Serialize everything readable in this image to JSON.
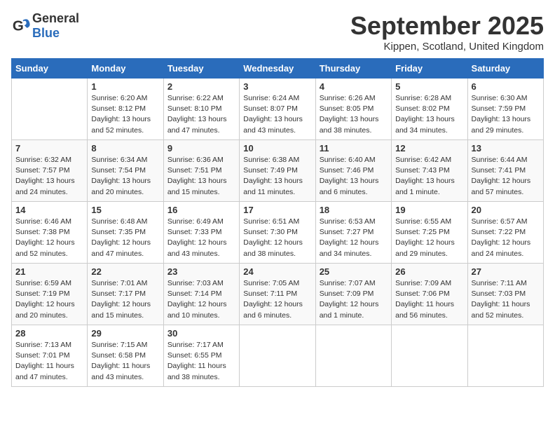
{
  "header": {
    "logo_general": "General",
    "logo_blue": "Blue",
    "month_title": "September 2025",
    "location": "Kippen, Scotland, United Kingdom"
  },
  "weekdays": [
    "Sunday",
    "Monday",
    "Tuesday",
    "Wednesday",
    "Thursday",
    "Friday",
    "Saturday"
  ],
  "weeks": [
    [
      {
        "day": "",
        "sunrise": "",
        "sunset": "",
        "daylight": ""
      },
      {
        "day": "1",
        "sunrise": "Sunrise: 6:20 AM",
        "sunset": "Sunset: 8:12 PM",
        "daylight": "Daylight: 13 hours and 52 minutes."
      },
      {
        "day": "2",
        "sunrise": "Sunrise: 6:22 AM",
        "sunset": "Sunset: 8:10 PM",
        "daylight": "Daylight: 13 hours and 47 minutes."
      },
      {
        "day": "3",
        "sunrise": "Sunrise: 6:24 AM",
        "sunset": "Sunset: 8:07 PM",
        "daylight": "Daylight: 13 hours and 43 minutes."
      },
      {
        "day": "4",
        "sunrise": "Sunrise: 6:26 AM",
        "sunset": "Sunset: 8:05 PM",
        "daylight": "Daylight: 13 hours and 38 minutes."
      },
      {
        "day": "5",
        "sunrise": "Sunrise: 6:28 AM",
        "sunset": "Sunset: 8:02 PM",
        "daylight": "Daylight: 13 hours and 34 minutes."
      },
      {
        "day": "6",
        "sunrise": "Sunrise: 6:30 AM",
        "sunset": "Sunset: 7:59 PM",
        "daylight": "Daylight: 13 hours and 29 minutes."
      }
    ],
    [
      {
        "day": "7",
        "sunrise": "Sunrise: 6:32 AM",
        "sunset": "Sunset: 7:57 PM",
        "daylight": "Daylight: 13 hours and 24 minutes."
      },
      {
        "day": "8",
        "sunrise": "Sunrise: 6:34 AM",
        "sunset": "Sunset: 7:54 PM",
        "daylight": "Daylight: 13 hours and 20 minutes."
      },
      {
        "day": "9",
        "sunrise": "Sunrise: 6:36 AM",
        "sunset": "Sunset: 7:51 PM",
        "daylight": "Daylight: 13 hours and 15 minutes."
      },
      {
        "day": "10",
        "sunrise": "Sunrise: 6:38 AM",
        "sunset": "Sunset: 7:49 PM",
        "daylight": "Daylight: 13 hours and 11 minutes."
      },
      {
        "day": "11",
        "sunrise": "Sunrise: 6:40 AM",
        "sunset": "Sunset: 7:46 PM",
        "daylight": "Daylight: 13 hours and 6 minutes."
      },
      {
        "day": "12",
        "sunrise": "Sunrise: 6:42 AM",
        "sunset": "Sunset: 7:43 PM",
        "daylight": "Daylight: 13 hours and 1 minute."
      },
      {
        "day": "13",
        "sunrise": "Sunrise: 6:44 AM",
        "sunset": "Sunset: 7:41 PM",
        "daylight": "Daylight: 12 hours and 57 minutes."
      }
    ],
    [
      {
        "day": "14",
        "sunrise": "Sunrise: 6:46 AM",
        "sunset": "Sunset: 7:38 PM",
        "daylight": "Daylight: 12 hours and 52 minutes."
      },
      {
        "day": "15",
        "sunrise": "Sunrise: 6:48 AM",
        "sunset": "Sunset: 7:35 PM",
        "daylight": "Daylight: 12 hours and 47 minutes."
      },
      {
        "day": "16",
        "sunrise": "Sunrise: 6:49 AM",
        "sunset": "Sunset: 7:33 PM",
        "daylight": "Daylight: 12 hours and 43 minutes."
      },
      {
        "day": "17",
        "sunrise": "Sunrise: 6:51 AM",
        "sunset": "Sunset: 7:30 PM",
        "daylight": "Daylight: 12 hours and 38 minutes."
      },
      {
        "day": "18",
        "sunrise": "Sunrise: 6:53 AM",
        "sunset": "Sunset: 7:27 PM",
        "daylight": "Daylight: 12 hours and 34 minutes."
      },
      {
        "day": "19",
        "sunrise": "Sunrise: 6:55 AM",
        "sunset": "Sunset: 7:25 PM",
        "daylight": "Daylight: 12 hours and 29 minutes."
      },
      {
        "day": "20",
        "sunrise": "Sunrise: 6:57 AM",
        "sunset": "Sunset: 7:22 PM",
        "daylight": "Daylight: 12 hours and 24 minutes."
      }
    ],
    [
      {
        "day": "21",
        "sunrise": "Sunrise: 6:59 AM",
        "sunset": "Sunset: 7:19 PM",
        "daylight": "Daylight: 12 hours and 20 minutes."
      },
      {
        "day": "22",
        "sunrise": "Sunrise: 7:01 AM",
        "sunset": "Sunset: 7:17 PM",
        "daylight": "Daylight: 12 hours and 15 minutes."
      },
      {
        "day": "23",
        "sunrise": "Sunrise: 7:03 AM",
        "sunset": "Sunset: 7:14 PM",
        "daylight": "Daylight: 12 hours and 10 minutes."
      },
      {
        "day": "24",
        "sunrise": "Sunrise: 7:05 AM",
        "sunset": "Sunset: 7:11 PM",
        "daylight": "Daylight: 12 hours and 6 minutes."
      },
      {
        "day": "25",
        "sunrise": "Sunrise: 7:07 AM",
        "sunset": "Sunset: 7:09 PM",
        "daylight": "Daylight: 12 hours and 1 minute."
      },
      {
        "day": "26",
        "sunrise": "Sunrise: 7:09 AM",
        "sunset": "Sunset: 7:06 PM",
        "daylight": "Daylight: 11 hours and 56 minutes."
      },
      {
        "day": "27",
        "sunrise": "Sunrise: 7:11 AM",
        "sunset": "Sunset: 7:03 PM",
        "daylight": "Daylight: 11 hours and 52 minutes."
      }
    ],
    [
      {
        "day": "28",
        "sunrise": "Sunrise: 7:13 AM",
        "sunset": "Sunset: 7:01 PM",
        "daylight": "Daylight: 11 hours and 47 minutes."
      },
      {
        "day": "29",
        "sunrise": "Sunrise: 7:15 AM",
        "sunset": "Sunset: 6:58 PM",
        "daylight": "Daylight: 11 hours and 43 minutes."
      },
      {
        "day": "30",
        "sunrise": "Sunrise: 7:17 AM",
        "sunset": "Sunset: 6:55 PM",
        "daylight": "Daylight: 11 hours and 38 minutes."
      },
      {
        "day": "",
        "sunrise": "",
        "sunset": "",
        "daylight": ""
      },
      {
        "day": "",
        "sunrise": "",
        "sunset": "",
        "daylight": ""
      },
      {
        "day": "",
        "sunrise": "",
        "sunset": "",
        "daylight": ""
      },
      {
        "day": "",
        "sunrise": "",
        "sunset": "",
        "daylight": ""
      }
    ]
  ]
}
